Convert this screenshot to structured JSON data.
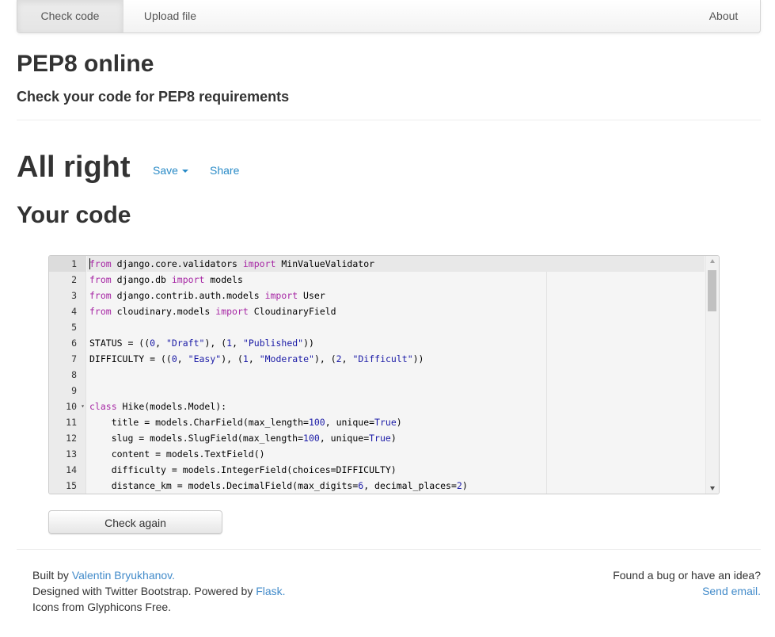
{
  "nav": {
    "check_code": "Check code",
    "upload_file": "Upload file",
    "about": "About"
  },
  "header": {
    "title": "PEP8 online",
    "subtitle": "Check your code for PEP8 requirements"
  },
  "result": {
    "title": "All right",
    "save_label": "Save",
    "share_label": "Share",
    "code_heading": "Your code"
  },
  "editor": {
    "active_line": 1,
    "lines": [
      {
        "n": "1",
        "code": "from django.core.validators import MinValueValidator"
      },
      {
        "n": "2",
        "code": "from django.db import models"
      },
      {
        "n": "3",
        "code": "from django.contrib.auth.models import User"
      },
      {
        "n": "4",
        "code": "from cloudinary.models import CloudinaryField"
      },
      {
        "n": "5",
        "code": ""
      },
      {
        "n": "6",
        "code": "STATUS = ((0, \"Draft\"), (1, \"Published\"))"
      },
      {
        "n": "7",
        "code": "DIFFICULTY = ((0, \"Easy\"), (1, \"Moderate\"), (2, \"Difficult\"))"
      },
      {
        "n": "8",
        "code": ""
      },
      {
        "n": "9",
        "code": ""
      },
      {
        "n": "10",
        "code": "class Hike(models.Model):",
        "fold": true
      },
      {
        "n": "11",
        "code": "    title = models.CharField(max_length=100, unique=True)"
      },
      {
        "n": "12",
        "code": "    slug = models.SlugField(max_length=100, unique=True)"
      },
      {
        "n": "13",
        "code": "    content = models.TextField()"
      },
      {
        "n": "14",
        "code": "    difficulty = models.IntegerField(choices=DIFFICULTY)"
      },
      {
        "n": "15",
        "code": "    distance_km = models.DecimalField(max_digits=6, decimal_places=2)"
      }
    ]
  },
  "actions": {
    "check_again": "Check again"
  },
  "footer": {
    "built_by_prefix": "Built by ",
    "author_link": "Valentin Bryukhanov.",
    "designed_prefix": "Designed with Twitter Bootstrap. Powered by ",
    "flask_link": "Flask.",
    "icons_text": "Icons from Glyphicons Free.",
    "bug_text": "Found a bug or have an idea?",
    "email_link": "Send email."
  },
  "colors": {
    "link": "#2a8bc7",
    "keyword": "#a626a4",
    "literal": "#1a1aa6"
  }
}
